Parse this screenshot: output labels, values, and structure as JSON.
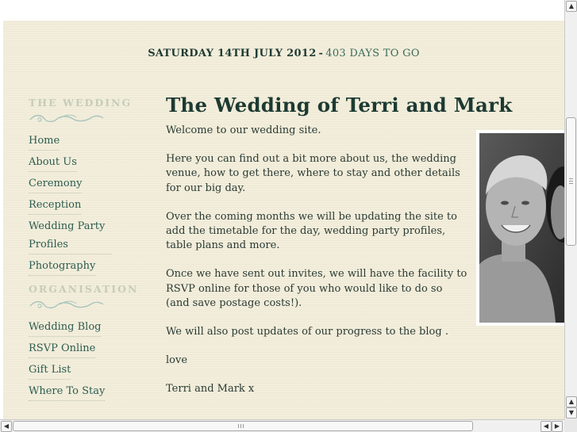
{
  "header": {
    "date": "SATURDAY 14TH JULY 2012",
    "separator": "-",
    "countdown": "403 DAYS TO GO"
  },
  "sidebar": {
    "section1_title": "THE WEDDING",
    "section1_items": [
      "Home",
      "About Us",
      "Ceremony",
      "Reception",
      "Wedding Party Profiles",
      "Photography"
    ],
    "section2_title": "ORGANISATION",
    "section2_items": [
      "Wedding Blog",
      "RSVP Online",
      "Gift List",
      "Where To Stay"
    ]
  },
  "main": {
    "title": "The Wedding of Terri and Mark",
    "paragraphs": [
      "Welcome to our wedding site.",
      "Here you can find out a bit more about us, the wedding venue, how to get there, where to stay and other details for our big day.",
      "Over the coming months we will be updating the site to add the timetable for the day, wedding party profiles, table plans and more.",
      "Once we have sent out invites, we will have the facility to RSVP online for those of you who would like to do so (and save postage costs!).",
      "We will also post updates of our progress to the blog .",
      "love",
      "Terri and Mark x"
    ]
  },
  "icons": {
    "flourish": "flourish-ornament",
    "scroll_up": "scroll-up-arrow",
    "scroll_down": "scroll-down-arrow",
    "scroll_left": "scroll-left-arrow",
    "scroll_right": "scroll-right-arrow"
  },
  "colors": {
    "background": "#f3eedb",
    "heading": "#1c3a32",
    "link": "#2c5c50",
    "section_title": "#c5cdb9"
  }
}
